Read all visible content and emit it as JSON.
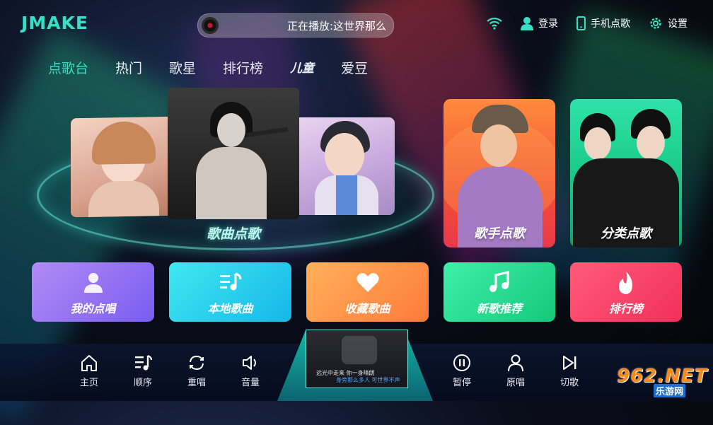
{
  "logo": "JMAKE",
  "now_playing": "正在播放:这世界那么",
  "top_right": {
    "login": "登录",
    "phone_song": "手机点歌",
    "settings": "设置",
    "icons": [
      "wifi-icon",
      "user-icon",
      "phone-icon",
      "gear-icon"
    ]
  },
  "tabs": [
    "点歌台",
    "热门",
    "歌星",
    "排行榜",
    "儿童",
    "爱豆"
  ],
  "active_tab": "点歌台",
  "hero": {
    "label": "歌曲点歌"
  },
  "cards": {
    "singer": "歌手点歌",
    "category": "分类点歌"
  },
  "features": [
    {
      "label": "我的点唱",
      "icon": "person-icon"
    },
    {
      "label": "本地歌曲",
      "icon": "music-list-icon"
    },
    {
      "label": "收藏歌曲",
      "icon": "heart-icon"
    },
    {
      "label": "新歌推荐",
      "icon": "music-note-icon"
    },
    {
      "label": "排行榜",
      "icon": "flame-icon"
    }
  ],
  "controls": {
    "home": "主页",
    "order": "顺序",
    "replay": "重唱",
    "volume": "音量",
    "pause": "暂停",
    "original": "原唱",
    "next": "切歌"
  },
  "video": {
    "subtitle_1": "远光中走来 你一身晴朗",
    "subtitle_2": "身旁那么多人 可世界不声"
  },
  "watermark": {
    "main": "962.NET",
    "sub": "乐游网"
  },
  "colors": {
    "accent": "#35e0c6"
  }
}
